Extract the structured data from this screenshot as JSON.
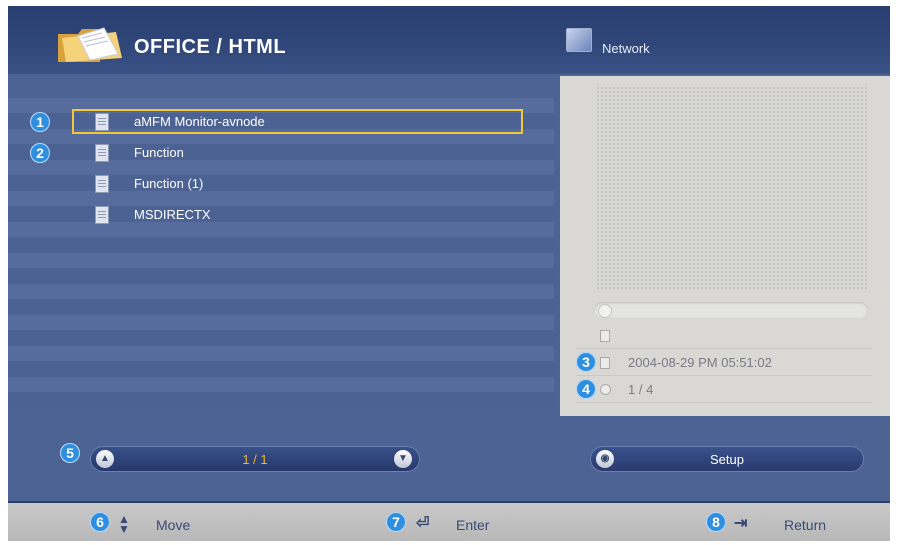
{
  "header": {
    "title": "OFFICE / HTML",
    "network_label": "Network"
  },
  "files": [
    {
      "number": "1",
      "name": "aMFM Monitor-avnode",
      "selected": true
    },
    {
      "number": "2",
      "name": "Function",
      "selected": false
    },
    {
      "number": "",
      "name": "Function (1)",
      "selected": false
    },
    {
      "number": "",
      "name": "MSDIRECTX",
      "selected": false
    }
  ],
  "info": {
    "date_number": "3",
    "date": "2004-08-29 PM 05:51:02",
    "index_number": "4",
    "index": "1 / 4"
  },
  "pager": {
    "number": "5",
    "page": "1 / 1"
  },
  "setup": {
    "label": "Setup"
  },
  "footer": {
    "move": {
      "number": "6",
      "label": "Move"
    },
    "enter": {
      "number": "7",
      "label": "Enter"
    },
    "return": {
      "number": "8",
      "label": "Return"
    }
  },
  "colors": {
    "selection": "#f2c83a",
    "badge": "#2f8fde",
    "page_text": "#e8b830"
  }
}
